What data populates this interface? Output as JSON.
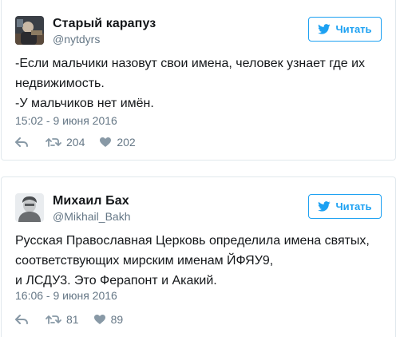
{
  "tweets": [
    {
      "author_name": "Старый карапуз",
      "handle": "@nytdyrs",
      "follow_label": "Читать",
      "text": "-Если мальчики назовут свои имена, человек узнает где их недвижимость.\n-У мальчиков нет имён.",
      "timestamp": "15:02 - 9 июня 2016",
      "retweets": "204",
      "likes": "202"
    },
    {
      "author_name": "Михаил Бах",
      "handle": "@Mikhail_Bakh",
      "follow_label": "Читать",
      "text": "Русская Православная Церковь определила имена святых, соответствующих мирским именам ЙФЯУ9,\nи ЛСДУ3. Это Ферапонт и Акакий.",
      "timestamp": "16:06 - 9 июня 2016",
      "retweets": "81",
      "likes": "89"
    }
  ],
  "colors": {
    "accent": "#1da1f2",
    "muted": "#657786",
    "border": "#e1e8ed",
    "text": "#14171a"
  },
  "icons": {
    "bird": "twitter-bird-icon",
    "reply": "reply-icon",
    "retweet": "retweet-icon",
    "like": "heart-icon"
  }
}
